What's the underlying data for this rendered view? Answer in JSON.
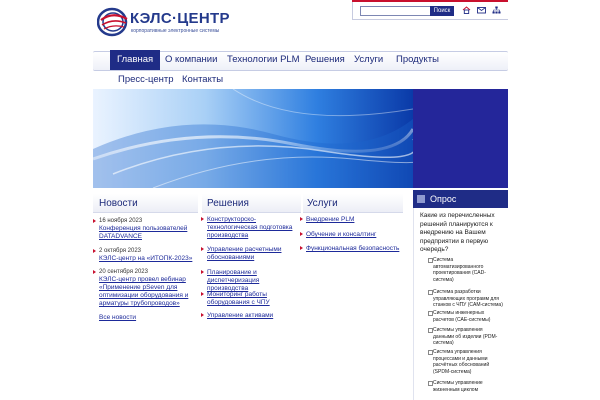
{
  "brand": {
    "name": "КЭЛС·ЦЕНТР",
    "tagline": "корпоративные электронные системы"
  },
  "topbar": {
    "search_placeholder": "",
    "search_button": "Поиск",
    "icons": [
      "home-icon",
      "mail-icon",
      "sitemap-icon"
    ]
  },
  "menu": {
    "row1": [
      "Главная",
      "О компании",
      "Технологии PLM",
      "Решения",
      "Услуги",
      "Продукты"
    ],
    "row2": [
      "Пресс-центр",
      "Контакты"
    ],
    "active": "Главная"
  },
  "news": {
    "title": "Новости",
    "items": [
      {
        "date": "16 ноября 2023",
        "text": "Конференция пользователей DATADVANCE"
      },
      {
        "date": "2 октября 2023",
        "text": "КЭЛС-центр на «ИТОПК-2023»"
      },
      {
        "date": "20 сентября 2023",
        "text": "КЭЛС-центр провел вебинар «Применение pSeven для оптимизации оборудования и арматуры трубопроводов»"
      }
    ],
    "all_link": "Все новости"
  },
  "solutions": {
    "title": "Решения",
    "items": [
      "Конструкторско-технологическая подготовка производства",
      "Управление расчетными обоснованиями",
      "Планирование и диспетчеризация производства",
      "Мониторинг работы оборудования с ЧПУ",
      "Управление активами"
    ]
  },
  "services": {
    "title": "Услуги",
    "items": [
      "Внедрение PLM",
      "Обучение и консалтинг",
      "Функциональная безопасность"
    ]
  },
  "poll": {
    "title": "Опрос",
    "question": "Какие из перечисленных решений планируются к внедрению на Вашем предприятии в первую очередь?",
    "options": [
      "Система автоматизированного проектирования (CAD-система)",
      "Система разработки управляющих программ для станков с ЧПУ (CAM-система)",
      "Системы инженерных расчетов (CAE-системы)",
      "Системы управления данными об изделии (PDM-система)",
      "Система управления процессами и данными расчётных обоснований (SPDM-система)",
      "Системы управление жизненным циклом"
    ]
  },
  "colors": {
    "brand_blue": "#1f2c86",
    "accent_red": "#c8102e",
    "banner_dark": "#24269a"
  }
}
